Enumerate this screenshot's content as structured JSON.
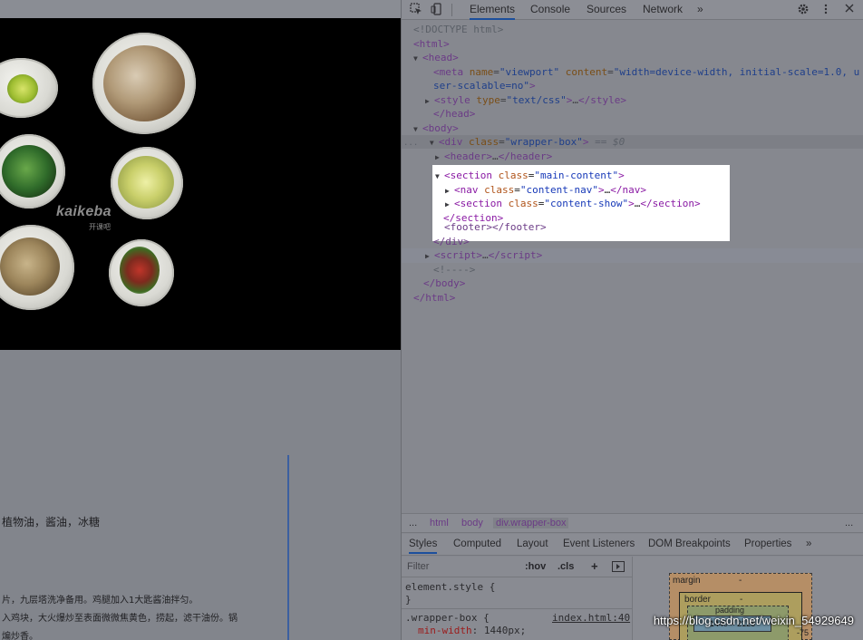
{
  "page": {
    "brand_en": "kaikeba",
    "brand_cn": "开课吧",
    "ingredients": "植物油，酱油，冰糖",
    "steps": [
      "片，九层塔洗净备用。鸡腿加入1大匙酱油拌匀。",
      "入鸡块，大火爆炒至表面微微焦黄色，捞起，滤干油份。锅",
      "煸炒香。"
    ]
  },
  "devtools": {
    "tabs": [
      "Elements",
      "Console",
      "Sources",
      "Network"
    ],
    "more": "»",
    "dom": {
      "doctype": "<!DOCTYPE html>",
      "html_open": "html",
      "head_open": "head",
      "meta_tag": "meta",
      "meta_name_attr": "name",
      "meta_name_val": "viewport",
      "meta_content_attr": "content",
      "meta_content_val_1": "width=device-width, initial-scale=1.0, u",
      "meta_content_val_2": "ser-scalable=no",
      "style_tag": "style",
      "style_type_attr": "type",
      "style_type_val": "text/css",
      "head_close": "/head",
      "body_open": "body",
      "div_tag": "div",
      "div_class_val": "wrapper-box",
      "selected_marker": "== $0",
      "header_tag": "header",
      "section_tag": "section",
      "section_class_val": "main-content",
      "nav_tag": "nav",
      "nav_class_val": "content-nav",
      "section2_class_val": "content-show",
      "section_close": "/section",
      "footer_tag": "footer",
      "div_close": "/div",
      "script_tag": "script",
      "comment": "<!---->",
      "body_close": "/body",
      "html_close": "/html",
      "class_attr": "class",
      "ellipsis": "…",
      "more_dots": "..."
    },
    "breadcrumb": [
      "html",
      "body",
      "div.wrapper-box"
    ],
    "subtabs": [
      "Styles",
      "Computed",
      "Layout",
      "Event Listeners",
      "DOM Breakpoints",
      "Properties"
    ],
    "filter_placeholder": "Filter",
    "hov": ":hov",
    "cls": ".cls",
    "plus": "+",
    "styles": {
      "element_style": "element.style {",
      "close_brace": "}",
      "selector": ".wrapper-box {",
      "source": "index.html:40",
      "prop": "min-width",
      "value": "1440px;"
    },
    "boxmodel": {
      "margin_label": "margin",
      "margin_val": "-",
      "border_label": "border",
      "border_val": "-",
      "padding_label": "padding",
      "content": "1440 × 2128",
      "right_val": "-75"
    }
  },
  "watermark": "https://blog.csdn.net/weixin_54929649"
}
